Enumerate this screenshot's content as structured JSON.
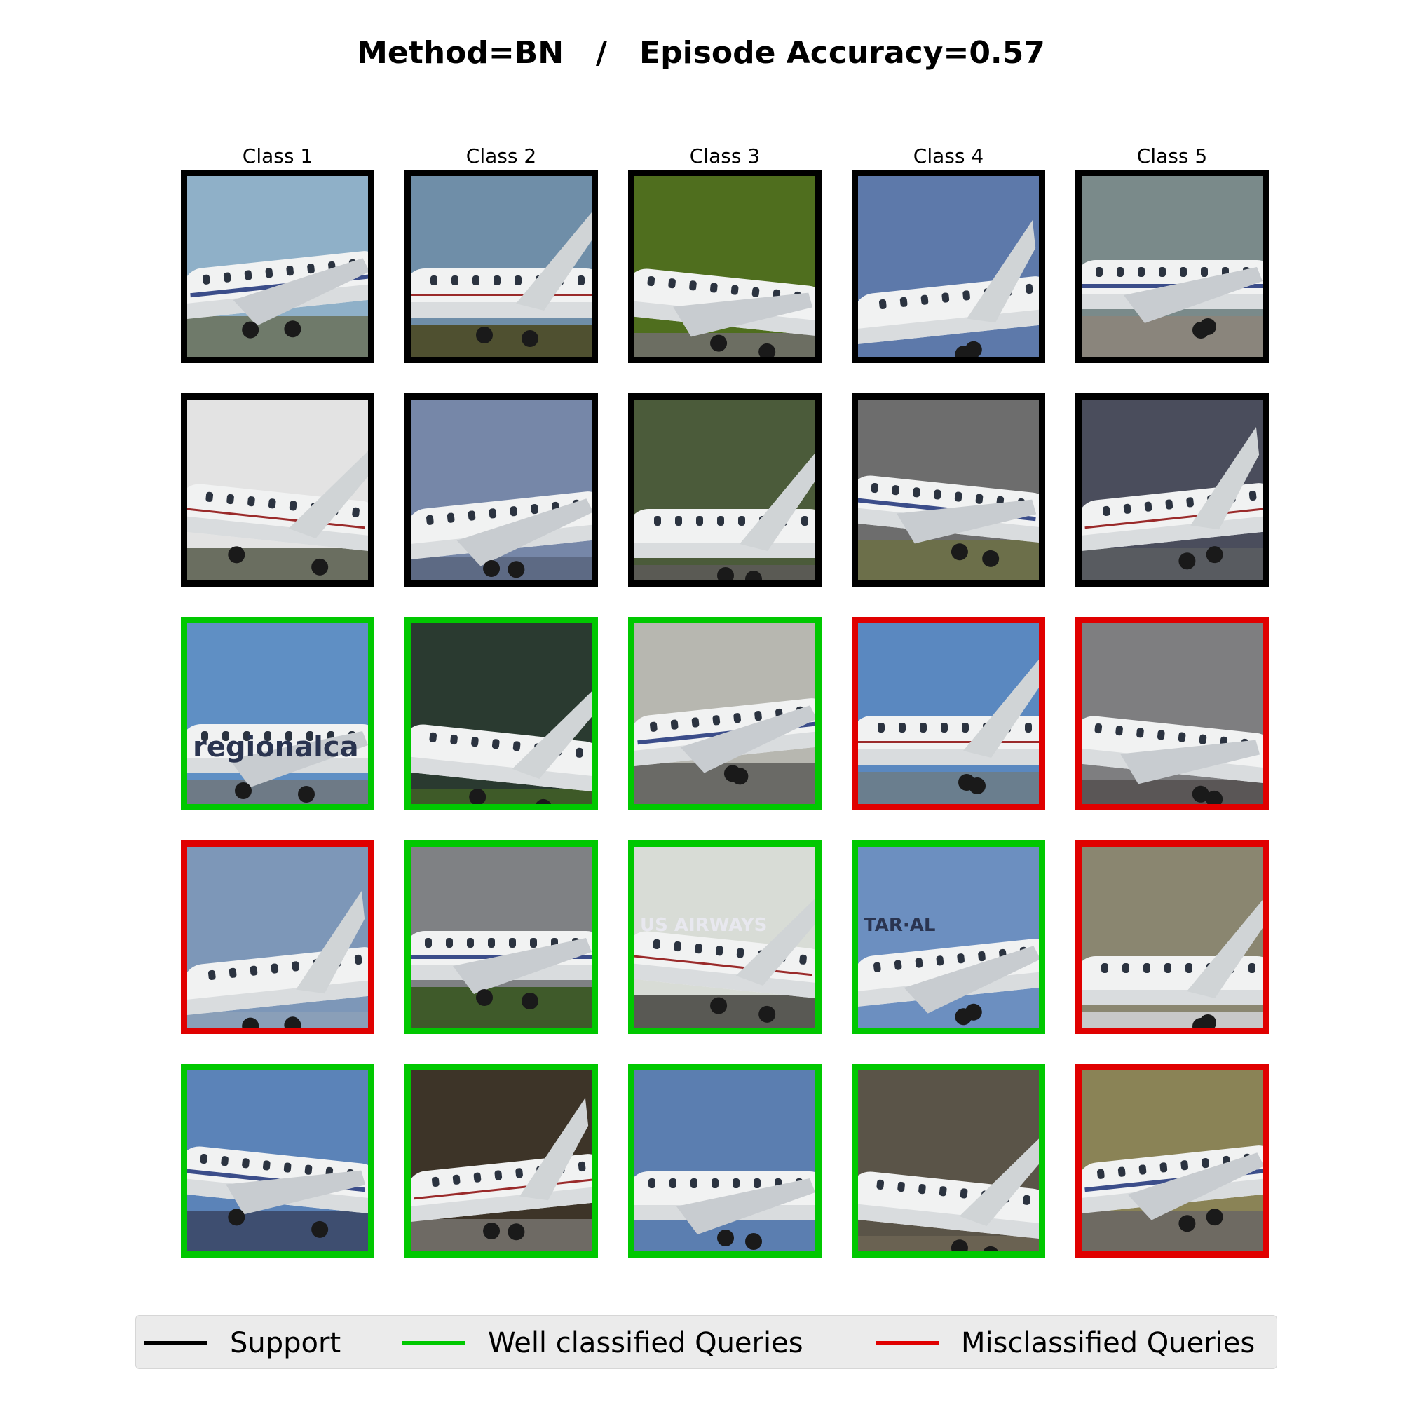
{
  "title": "Method=BN   /   Episode Accuracy=0.57",
  "colors": {
    "support": "#000000",
    "well_classified": "#00c800",
    "misclassified": "#e00000"
  },
  "class_labels": [
    "Class 1",
    "Class 2",
    "Class 3",
    "Class 4",
    "Class 5"
  ],
  "grid": [
    [
      "support",
      "support",
      "support",
      "support",
      "support"
    ],
    [
      "support",
      "support",
      "support",
      "support",
      "support"
    ],
    [
      "well_classified",
      "well_classified",
      "well_classified",
      "misclassified",
      "misclassified"
    ],
    [
      "misclassified",
      "well_classified",
      "well_classified",
      "well_classified",
      "misclassified"
    ],
    [
      "well_classified",
      "well_classified",
      "well_classified",
      "well_classified",
      "misclassified"
    ]
  ],
  "image_texts": {
    "r2c0": "regionalca",
    "r3c2": "US AIRWAYS",
    "r3c3": "TAR·AL"
  },
  "legend": [
    {
      "label": "Support",
      "color": "#000000"
    },
    {
      "label": "Well classified Queries",
      "color": "#00c800"
    },
    {
      "label": "Misclassified Queries",
      "color": "#e00000"
    }
  ]
}
